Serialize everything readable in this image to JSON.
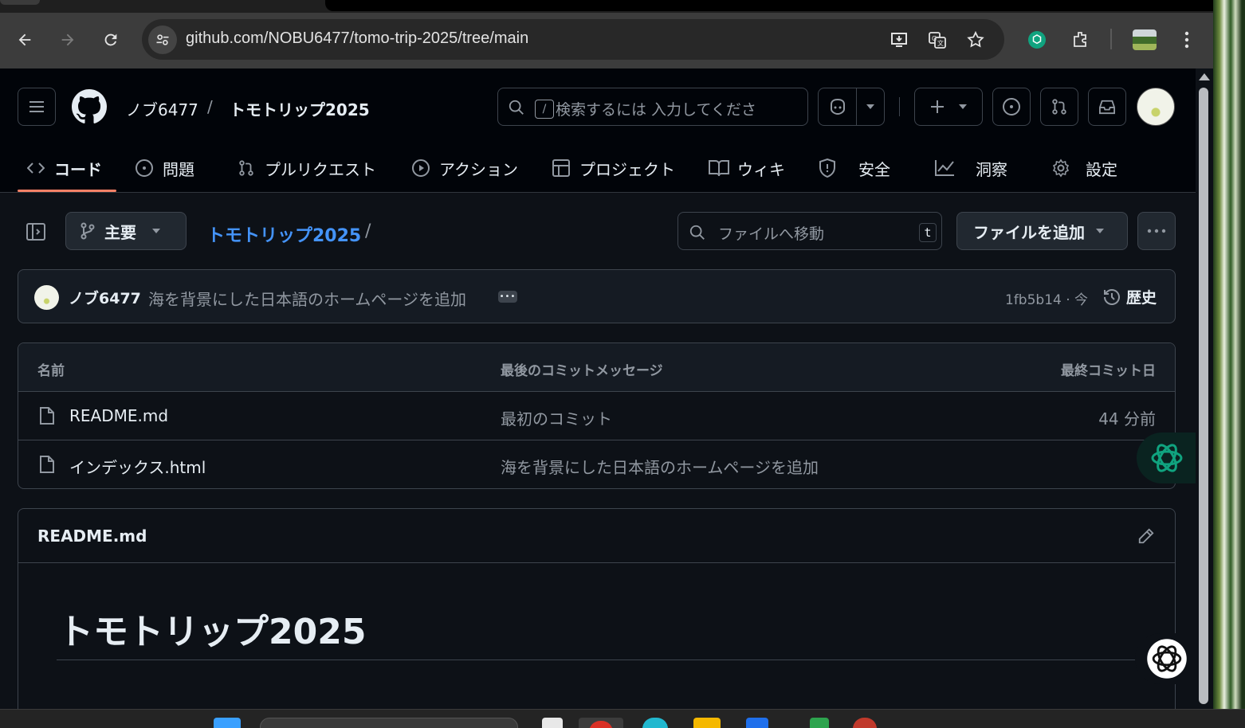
{
  "browser": {
    "url": "github.com/NOBU6477/tomo-trip-2025/tree/main",
    "icons": [
      "back-icon",
      "forward-icon",
      "reload-icon",
      "site-settings-icon",
      "install-app-icon",
      "translate-icon",
      "bookmark-star-icon",
      "chatgpt-extension-icon",
      "extensions-icon",
      "profile-avatar",
      "kebab-menu-icon"
    ]
  },
  "header": {
    "owner": "ノブ6477",
    "separator": "/",
    "repo": "トモトリップ2025",
    "search_kbd": "/",
    "search_placeholder": "検索するには 入力してくださ"
  },
  "repo_nav": {
    "tabs": [
      {
        "label": "コード",
        "icon": "code-icon",
        "active": true
      },
      {
        "label": "問題",
        "icon": "issue-icon"
      },
      {
        "label": "プルリクエスト",
        "icon": "pull-request-icon"
      },
      {
        "label": "アクション",
        "icon": "play-icon"
      },
      {
        "label": "プロジェクト",
        "icon": "table-icon"
      },
      {
        "label": "ウィキ",
        "icon": "book-icon"
      },
      {
        "label": "安全",
        "icon": "shield-icon"
      },
      {
        "label": "洞察",
        "icon": "graph-icon"
      },
      {
        "label": "設定",
        "icon": "gear-icon"
      }
    ]
  },
  "file_toolbar": {
    "branch": "主要",
    "breadcrumb_repo": "トモトリップ2025",
    "breadcrumb_sep": "/",
    "file_search_placeholder": "ファイルへ移動",
    "file_search_kbd": "t",
    "add_file_label": "ファイルを追加"
  },
  "latest_commit": {
    "author": "ノブ6477",
    "message": "海を背景にした日本語のホームページを追加",
    "ellipsis": "•••",
    "meta": "1fb5b14 · 今",
    "history_label": "歴史"
  },
  "file_table": {
    "headers": {
      "name": "名前",
      "message": "最後のコミットメッセージ",
      "date": "最終コミット日"
    },
    "rows": [
      {
        "name": "README.md",
        "message": "最初のコミット",
        "date": "44 分前"
      },
      {
        "name": "インデックス.html",
        "message": "海を背景にした日本語のホームページを追加",
        "date": ""
      }
    ]
  },
  "readme": {
    "filename": "README.md",
    "heading": "トモトリップ2025"
  },
  "colors": {
    "accent_link": "#4493f8",
    "active_tab_underline": "#f78166",
    "background": "#0d1117"
  }
}
